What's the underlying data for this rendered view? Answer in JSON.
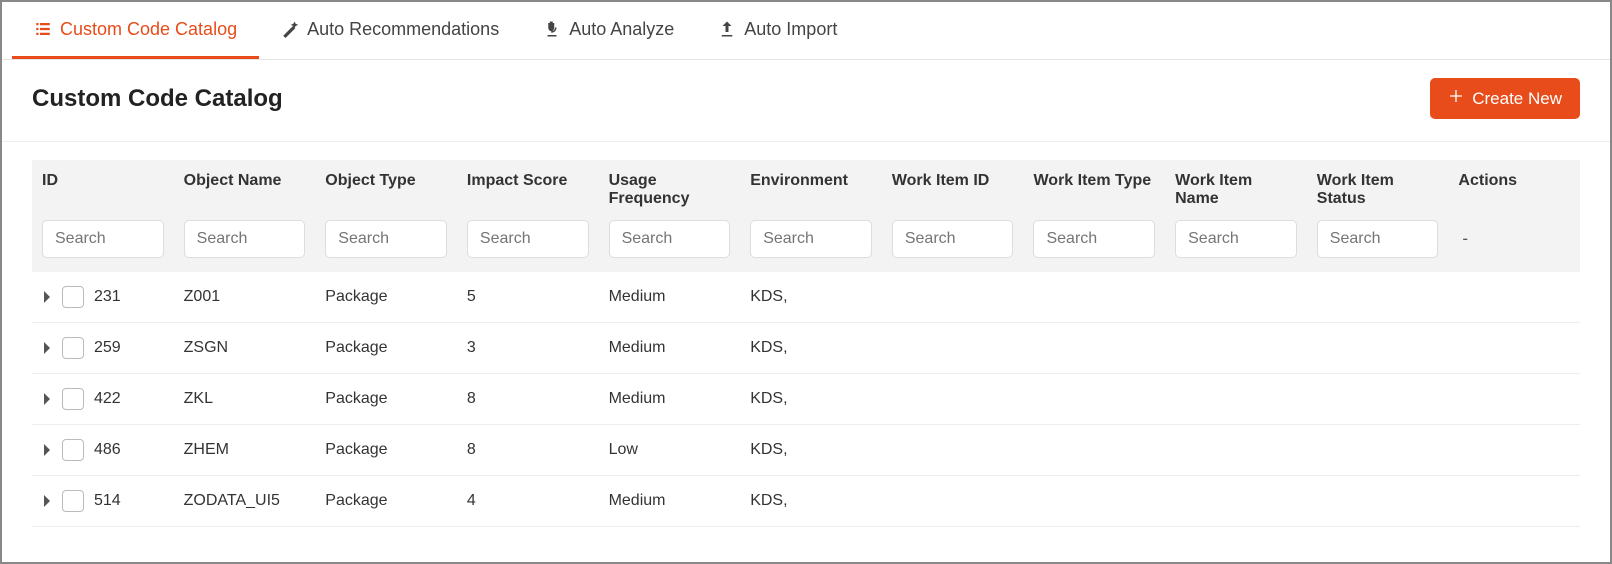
{
  "tabs": [
    {
      "label": "Custom Code Catalog",
      "active": true,
      "icon": "list"
    },
    {
      "label": "Auto Recommendations",
      "active": false,
      "icon": "wand"
    },
    {
      "label": "Auto Analyze",
      "active": false,
      "icon": "microscope"
    },
    {
      "label": "Auto Import",
      "active": false,
      "icon": "upload"
    }
  ],
  "header": {
    "title": "Custom Code Catalog",
    "create_label": "Create New"
  },
  "columns": {
    "id": "ID",
    "object_name": "Object Name",
    "object_type": "Object Type",
    "impact_score": "Impact Score",
    "usage_frequency": "Usage Frequency",
    "environment": "Environment",
    "work_item_id": "Work Item ID",
    "work_item_type": "Work Item Type",
    "work_item_name": "Work Item Name",
    "work_item_status": "Work Item Status",
    "actions": "Actions"
  },
  "search_placeholder": "Search",
  "actions_filter": "-",
  "rows": [
    {
      "id": "231",
      "object_name": "Z001",
      "object_type": "Package",
      "impact_score": "5",
      "usage_frequency": "Medium",
      "environment": "KDS,",
      "work_item_id": "",
      "work_item_type": "",
      "work_item_name": "",
      "work_item_status": ""
    },
    {
      "id": "259",
      "object_name": "ZSGN",
      "object_type": "Package",
      "impact_score": "3",
      "usage_frequency": "Medium",
      "environment": "KDS,",
      "work_item_id": "",
      "work_item_type": "",
      "work_item_name": "",
      "work_item_status": ""
    },
    {
      "id": "422",
      "object_name": "ZKL",
      "object_type": "Package",
      "impact_score": "8",
      "usage_frequency": "Medium",
      "environment": "KDS,",
      "work_item_id": "",
      "work_item_type": "",
      "work_item_name": "",
      "work_item_status": ""
    },
    {
      "id": "486",
      "object_name": "ZHEM",
      "object_type": "Package",
      "impact_score": "8",
      "usage_frequency": "Low",
      "environment": "KDS,",
      "work_item_id": "",
      "work_item_type": "",
      "work_item_name": "",
      "work_item_status": ""
    },
    {
      "id": "514",
      "object_name": "ZODATA_UI5",
      "object_type": "Package",
      "impact_score": "4",
      "usage_frequency": "Medium",
      "environment": "KDS,",
      "work_item_id": "",
      "work_item_type": "",
      "work_item_name": "",
      "work_item_status": ""
    }
  ]
}
